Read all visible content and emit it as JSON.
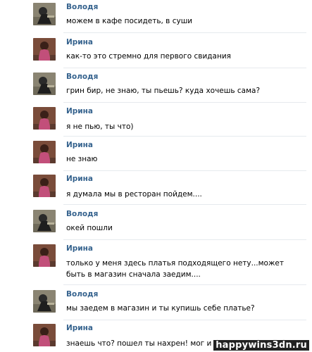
{
  "messages": [
    {
      "sender": "Володя",
      "text": "можем в кафе посидеть, в суши",
      "avatar": "volodya"
    },
    {
      "sender": "Ирина",
      "text": "как-то это стремно для первого свидания",
      "avatar": "irina"
    },
    {
      "sender": "Володя",
      "text": "грин бир, не знаю, ты пьешь? куда хочешь сама?",
      "avatar": "volodya"
    },
    {
      "sender": "Ирина",
      "text": "я не пью, ты что)",
      "avatar": "irina"
    },
    {
      "sender": "Ирина",
      "text": "не знаю",
      "avatar": "irina"
    },
    {
      "sender": "Ирина",
      "text": "я думала мы в ресторан пойдем....",
      "avatar": "irina"
    },
    {
      "sender": "Володя",
      "text": "окей пошли",
      "avatar": "volodya"
    },
    {
      "sender": "Ирина",
      "text": "только у меня здесь платья подходящего нету...может быть в магазин сначала заедим....",
      "avatar": "irina"
    },
    {
      "sender": "Володя",
      "text": "мы заедем в магазин и ты купишь себе платье?",
      "avatar": "volodya"
    },
    {
      "sender": "Ирина",
      "text": "знаешь что? пошел ты нахрен! мог и подарок сделать!",
      "avatar": "irina"
    }
  ],
  "watermark": "happywins3dn.ru",
  "colors": {
    "name": "#36638e",
    "separator": "#e6eaee"
  }
}
